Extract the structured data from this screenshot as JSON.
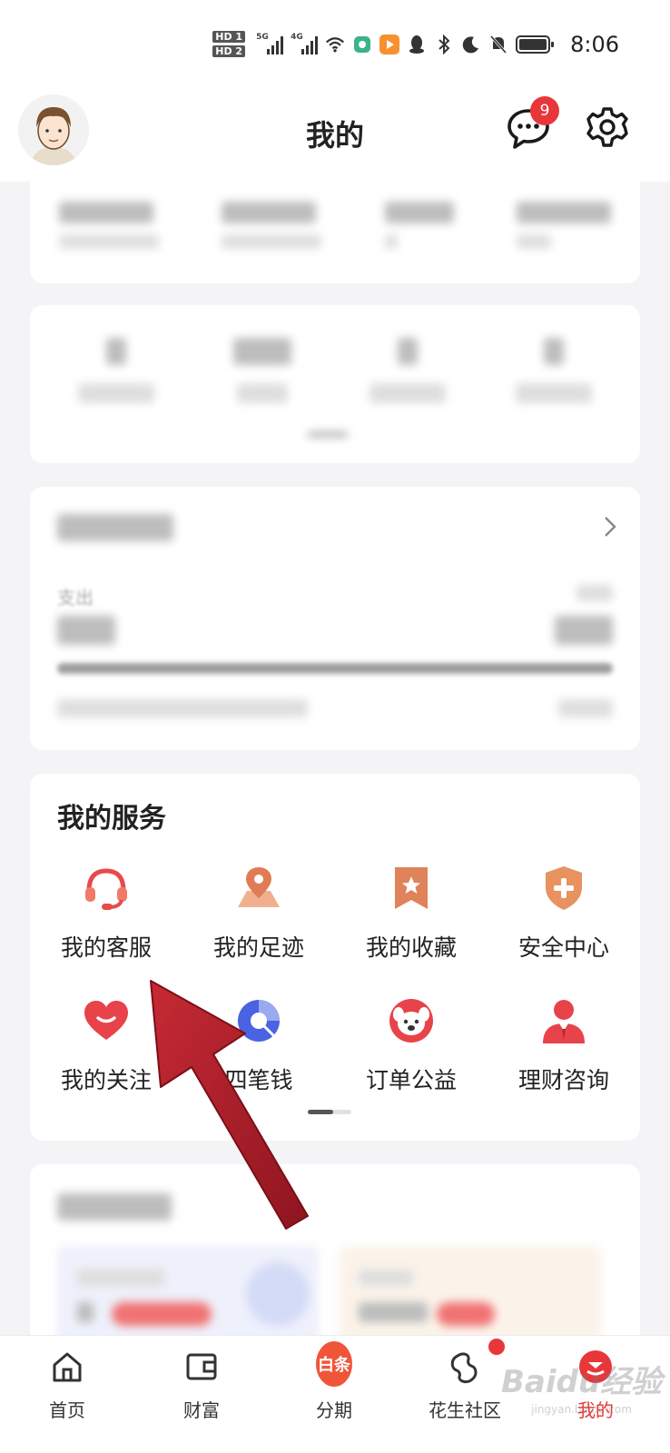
{
  "status_bar": {
    "hd1": "HD 1",
    "hd2": "HD 2",
    "network1": "5G",
    "network2": "4G",
    "time": "8:06"
  },
  "header": {
    "title": "我的",
    "message_badge": "9"
  },
  "wallet_card": {
    "obscured": true
  },
  "assets_card": {
    "obscured": true
  },
  "bill_card": {
    "expense_label": "支出"
  },
  "services": {
    "title": "我的服务",
    "items": [
      {
        "label": "我的客服",
        "icon": "headset-icon"
      },
      {
        "label": "我的足迹",
        "icon": "map-pin-icon"
      },
      {
        "label": "我的收藏",
        "icon": "bookmark-star-icon"
      },
      {
        "label": "安全中心",
        "icon": "shield-plus-icon"
      },
      {
        "label": "我的关注",
        "icon": "heart-icon"
      },
      {
        "label": "四笔钱",
        "icon": "pie-chart-icon"
      },
      {
        "label": "订单公益",
        "icon": "dog-face-icon"
      },
      {
        "label": "理财咨询",
        "icon": "advisor-icon"
      }
    ]
  },
  "tabbar": {
    "items": [
      {
        "label": "首页",
        "icon": "home-icon"
      },
      {
        "label": "财富",
        "icon": "wallet-icon"
      },
      {
        "label": "分期",
        "icon": "baitiao-icon",
        "icon_text": "白条"
      },
      {
        "label": "花生社区",
        "icon": "peanut-icon"
      },
      {
        "label": "我的",
        "icon": "profile-icon",
        "active": true
      }
    ]
  },
  "watermark": {
    "text": "Baidu经验",
    "url": "jingyan.baidu.com"
  },
  "colors": {
    "accent_red": "#e8373a",
    "icon_orange": "#e0825a",
    "icon_blue": "#4a63e0",
    "arrow_red": "#b0202a"
  }
}
